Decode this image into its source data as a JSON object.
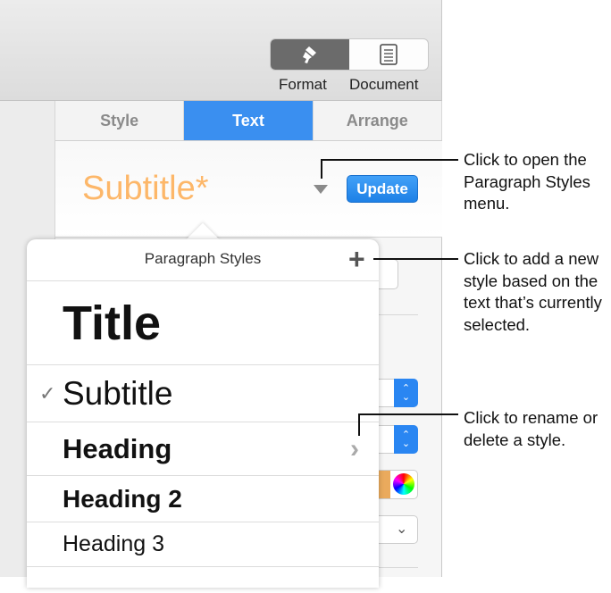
{
  "toolbar": {
    "format_label": "Format",
    "document_label": "Document"
  },
  "tabs": [
    {
      "label": "Style"
    },
    {
      "label": "Text"
    },
    {
      "label": "Arrange"
    }
  ],
  "current_style": "Subtitle*",
  "update_label": "Update",
  "popover": {
    "title": "Paragraph Styles",
    "add_symbol": "+",
    "checkmark": "✓",
    "chevron": "›",
    "items": [
      {
        "label": "Title"
      },
      {
        "label": "Subtitle"
      },
      {
        "label": "Heading"
      },
      {
        "label": "Heading 2"
      },
      {
        "label": "Heading 3"
      }
    ]
  },
  "callouts": [
    "Click to open the Paragraph Styles menu.",
    "Click to add a new style based on the text that’s currently selected.",
    "Click to rename or delete a style."
  ],
  "colors": {
    "accent": "#3a8ff0",
    "style_name": "#fdb769"
  }
}
